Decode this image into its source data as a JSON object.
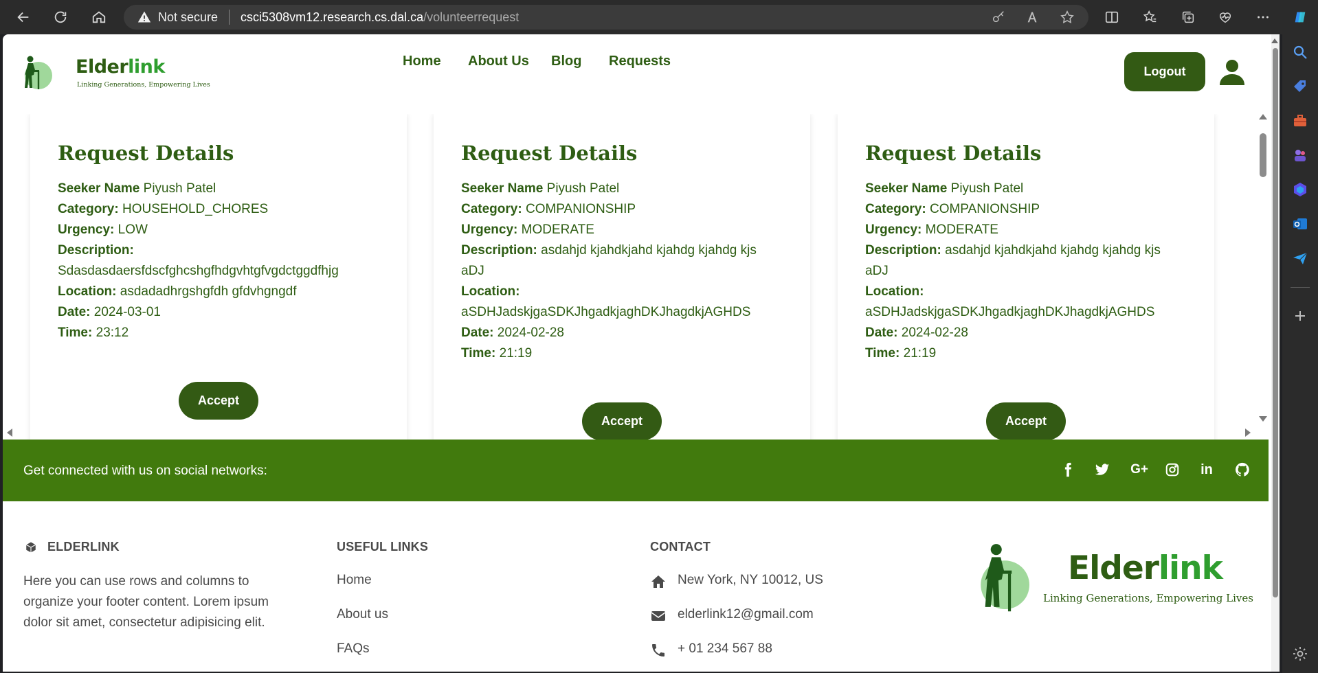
{
  "browser": {
    "security_label": "Not secure",
    "url_host": "csci5308vm12.research.cs.dal.ca",
    "url_path": "/volunteerrequest"
  },
  "header": {
    "logo_name_part1": "Elder",
    "logo_name_part2": "link",
    "logo_tagline": "Linking Generations, Empowering Lives",
    "nav": [
      "Home",
      "About Us",
      "Blog",
      "Requests"
    ],
    "logout_label": "Logout"
  },
  "requests": [
    {
      "title": "Request Details",
      "seeker_label": "Seeker Name",
      "seeker": "Piyush Patel",
      "category_label": "Category:",
      "category": "HOUSEHOLD_CHORES",
      "urgency_label": "Urgency:",
      "urgency": "LOW",
      "description_label": "Description:",
      "description": "Sdasdasdaersfdscfghcshgfhdgvhtgfvgdctggdfhjg",
      "location_label": "Location:",
      "location": "asdadadhrgshgfdh gfdvhgngdf",
      "date_label": "Date:",
      "date": "2024-03-01",
      "time_label": "Time:",
      "time": "23:12",
      "accept_label": "Accept"
    },
    {
      "title": "Request Details",
      "seeker_label": "Seeker Name",
      "seeker": "Piyush Patel",
      "category_label": "Category:",
      "category": "COMPANIONSHIP",
      "urgency_label": "Urgency:",
      "urgency": "MODERATE",
      "description_label": "Description:",
      "description": "asdahjd kjahdkjahd kjahdg kjahdg kjs aDJ",
      "location_label": "Location:",
      "location": "aSDHJadskjgaSDKJhgadkjaghDKJhagdkjAGHDS",
      "date_label": "Date:",
      "date": "2024-02-28",
      "time_label": "Time:",
      "time": "21:19",
      "accept_label": "Accept"
    },
    {
      "title": "Request Details",
      "seeker_label": "Seeker Name",
      "seeker": "Piyush Patel",
      "category_label": "Category:",
      "category": "COMPANIONSHIP",
      "urgency_label": "Urgency:",
      "urgency": "MODERATE",
      "description_label": "Description:",
      "description": "asdahjd kjahdkjahd kjahdg kjahdg kjs aDJ",
      "location_label": "Location:",
      "location": "aSDHJadskjgaSDKJhgadkjaghDKJhagdkjAGHDS",
      "date_label": "Date:",
      "date": "2024-02-28",
      "time_label": "Time:",
      "time": "21:19",
      "accept_label": "Accept"
    }
  ],
  "social": {
    "text": "Get connected with us on social networks:",
    "icons": [
      "facebook-icon",
      "twitter-icon",
      "google-plus-icon",
      "instagram-icon",
      "linkedin-icon",
      "github-icon"
    ],
    "google_plus_glyph": "G+",
    "linkedin_glyph": "in"
  },
  "footer": {
    "brand_heading": "ELDERLINK",
    "brand_text": "Here you can use rows and columns to organize your footer content. Lorem ipsum dolor sit amet, consectetur adipisicing elit.",
    "links_heading": "USEFUL LINKS",
    "links": [
      "Home",
      "About us",
      "FAQs"
    ],
    "contact_heading": "CONTACT",
    "address": "New York, NY 10012, US",
    "email": "elderlink12@gmail.com",
    "phone": "+ 01 234 567 88",
    "logo_name_part1": "Elder",
    "logo_name_part2": "link",
    "logo_tagline": "Linking Generations, Empowering Lives"
  },
  "colors": {
    "brand_dark": "#2e5d13",
    "button": "#335a14",
    "social_band": "#417a0d"
  }
}
